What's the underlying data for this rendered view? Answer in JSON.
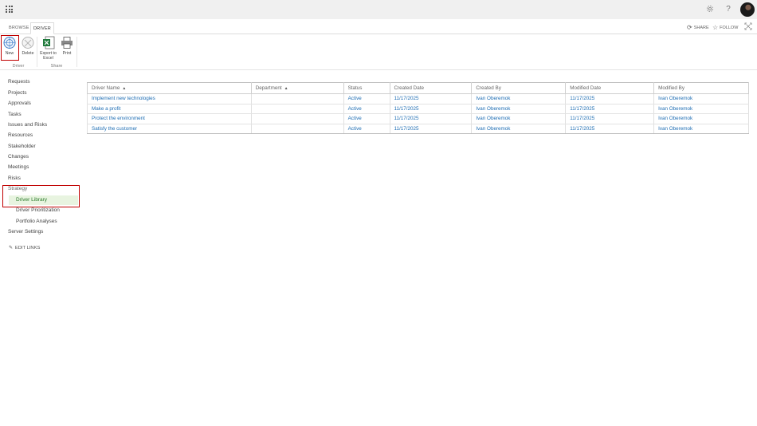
{
  "suite": {
    "settings_icon": "gear-icon",
    "help_label": "?",
    "avatar": "user-avatar"
  },
  "tabs": [
    {
      "label": "BROWSE"
    },
    {
      "label": "DRIVER"
    }
  ],
  "tab_actions": {
    "share_label": "SHARE",
    "follow_label": "FOLLOW",
    "focus_icon": "focus-on-content-icon"
  },
  "ribbon": {
    "buttons": [
      {
        "label": "New"
      },
      {
        "label": "Delete"
      },
      {
        "label_line1": "Export to",
        "label_line2": "Excel"
      },
      {
        "label": "Print"
      }
    ],
    "groups": [
      {
        "label": "Driver"
      },
      {
        "label": "Share"
      }
    ]
  },
  "nav": {
    "items": [
      {
        "label": "Requests"
      },
      {
        "label": "Projects"
      },
      {
        "label": "Approvals"
      },
      {
        "label": "Tasks"
      },
      {
        "label": "Issues and Risks"
      },
      {
        "label": "Resources"
      },
      {
        "label": "Stakeholder"
      },
      {
        "label": "Changes"
      },
      {
        "label": "Meetings"
      },
      {
        "label": "Risks"
      },
      {
        "label": "Strategy"
      },
      {
        "label": "Driver Library"
      },
      {
        "label": "Driver Prioritization"
      },
      {
        "label": "Portfolio Analyses"
      },
      {
        "label": "Server Settings"
      }
    ],
    "edit_links_label": "EDIT LINKS"
  },
  "table": {
    "columns": [
      "Driver Name",
      "Department",
      "Status",
      "Created Date",
      "Created By",
      "Modified Date",
      "Modified By"
    ],
    "rows": [
      {
        "name": "Implement new technologies",
        "department": "",
        "status": "Active",
        "created": "11/17/2025",
        "created_by": "Ivan Oberemok",
        "modified": "11/17/2025",
        "modified_by": "Ivan Oberemok"
      },
      {
        "name": "Make a profit",
        "department": "",
        "status": "Active",
        "created": "11/17/2025",
        "created_by": "Ivan Oberemok",
        "modified": "11/17/2025",
        "modified_by": "Ivan Oberemok"
      },
      {
        "name": "Protect the environment",
        "department": "",
        "status": "Active",
        "created": "11/17/2025",
        "created_by": "Ivan Oberemok",
        "modified": "11/17/2025",
        "modified_by": "Ivan Oberemok"
      },
      {
        "name": "Satisfy the customer",
        "department": "",
        "status": "Active",
        "created": "11/17/2025",
        "created_by": "Ivan Oberemok",
        "modified": "11/17/2025",
        "modified_by": "Ivan Oberemok"
      }
    ]
  },
  "colors": {
    "link": "#1e6db3",
    "highlight": "#c00000",
    "selected_nav": "#e8f4e0"
  }
}
